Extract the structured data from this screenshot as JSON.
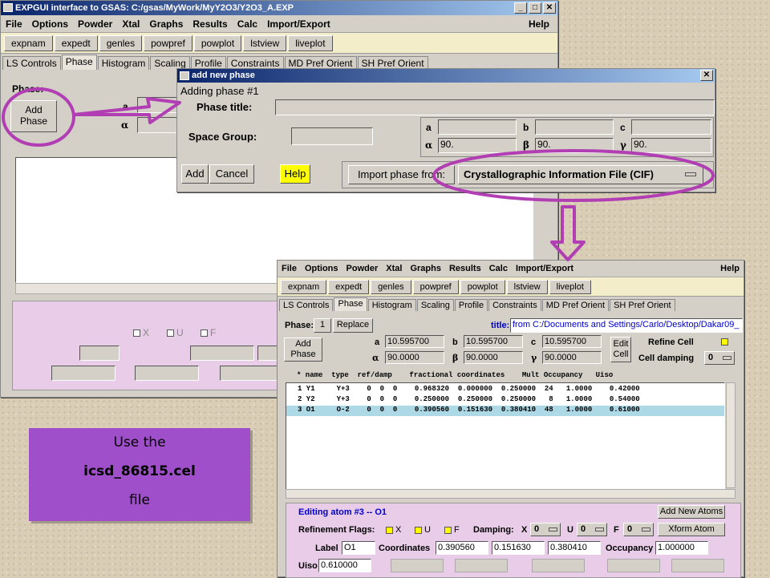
{
  "main_window": {
    "title": "EXPGUI interface to GSAS: C:/gsas/MyWork/MyY2O3/Y2O3_A.EXP",
    "menus": [
      "File",
      "Options",
      "Powder",
      "Xtal",
      "Graphs",
      "Results",
      "Calc",
      "Import/Export"
    ],
    "help": "Help",
    "buttons": [
      "expnam",
      "expedt",
      "genles",
      "powpref",
      "powplot",
      "lstview",
      "liveplot"
    ],
    "tabs": [
      "LS Controls",
      "Phase",
      "Histogram",
      "Scaling",
      "Profile",
      "Constraints",
      "MD Pref Orient",
      "SH Pref Orient"
    ],
    "phase_label": "Phase:",
    "add_phase": "Add\nPhase",
    "a": "a",
    "alpha": "α",
    "flags": {
      "x": "X",
      "u": "U",
      "f": "F"
    }
  },
  "dialog": {
    "title": "add new phase",
    "heading": "Adding phase #1",
    "phase_title_label": "Phase title:",
    "space_group_label": "Space Group:",
    "a": "a",
    "b": "b",
    "c": "c",
    "alpha": "α",
    "beta": "β",
    "gamma": "γ",
    "alpha_val": "90.",
    "beta_val": "90.",
    "gamma_val": "90.",
    "add": "Add",
    "cancel": "Cancel",
    "help": "Help",
    "import_from": "Import phase from:",
    "import_format": "Crystallographic Information File (CIF)"
  },
  "second_window": {
    "menus": [
      "File",
      "Options",
      "Powder",
      "Xtal",
      "Graphs",
      "Results",
      "Calc",
      "Import/Export"
    ],
    "help": "Help",
    "buttons": [
      "expnam",
      "expedt",
      "genles",
      "powpref",
      "powplot",
      "lstview",
      "liveplot"
    ],
    "tabs": [
      "LS Controls",
      "Phase",
      "Histogram",
      "Scaling",
      "Profile",
      "Constraints",
      "MD Pref Orient",
      "SH Pref Orient"
    ],
    "phase_label": "Phase:",
    "phase_num": "1",
    "replace": "Replace",
    "title_label": "title:",
    "title_value": "from C:/Documents and Settings/Carlo/Desktop/Dakar09_",
    "add_phase": "Add\nPhase",
    "a": "a",
    "b": "b",
    "c": "c",
    "alpha": "α",
    "beta": "β",
    "gamma": "γ",
    "a_val": "10.595700",
    "b_val": "10.595700",
    "c_val": "10.595700",
    "alpha_val": "90.0000",
    "beta_val": "90.0000",
    "gamma_val": "90.0000",
    "edit_cell": "Edit\nCell",
    "refine_cell": "Refine Cell",
    "cell_damping": "Cell damping",
    "cell_damping_val": "0",
    "atom_header": "* name  type  ref/damp    fractional coordinates    Mult Occupancy   Uiso",
    "atoms": [
      "1 Y1     Y+3    0  0  0    0.968320  0.000000  0.250000  24   1.0000    0.42000",
      "2 Y2     Y+3    0  0  0    0.250000  0.250000  0.250000   8   1.0000    0.54000",
      "3 O1     O-2    0  0  0    0.390560  0.151630  0.380410  48   1.0000    0.61000"
    ],
    "editing": "Editing atom #3 -- O1",
    "add_new_atoms": "Add New Atoms",
    "refinement_flags": "Refinement Flags:",
    "x": "X",
    "u": "U",
    "f": "F",
    "damping": "Damping:",
    "damp_x": "X",
    "damp_u": "U",
    "damp_f": "F",
    "damp_val": "0",
    "xform_atom": "Xform Atom",
    "label_lbl": "Label",
    "label_val": "O1",
    "coords_lbl": "Coordinates",
    "coord_x": "0.390560",
    "coord_y": "0.151630",
    "coord_z": "0.380410",
    "occ_lbl": "Occupancy",
    "occ_val": "1.000000",
    "uiso_lbl": "Uiso",
    "uiso_val": "0.610000"
  },
  "note": {
    "line1": "Use the",
    "line2": "icsd_86815.cel",
    "line3": "file"
  },
  "colors": {
    "annotation": "#b13fb3",
    "note_bg": "#9f4fc9",
    "highlight": "#add8e6",
    "pane": "#e8cce8",
    "help": "#ffff00"
  }
}
